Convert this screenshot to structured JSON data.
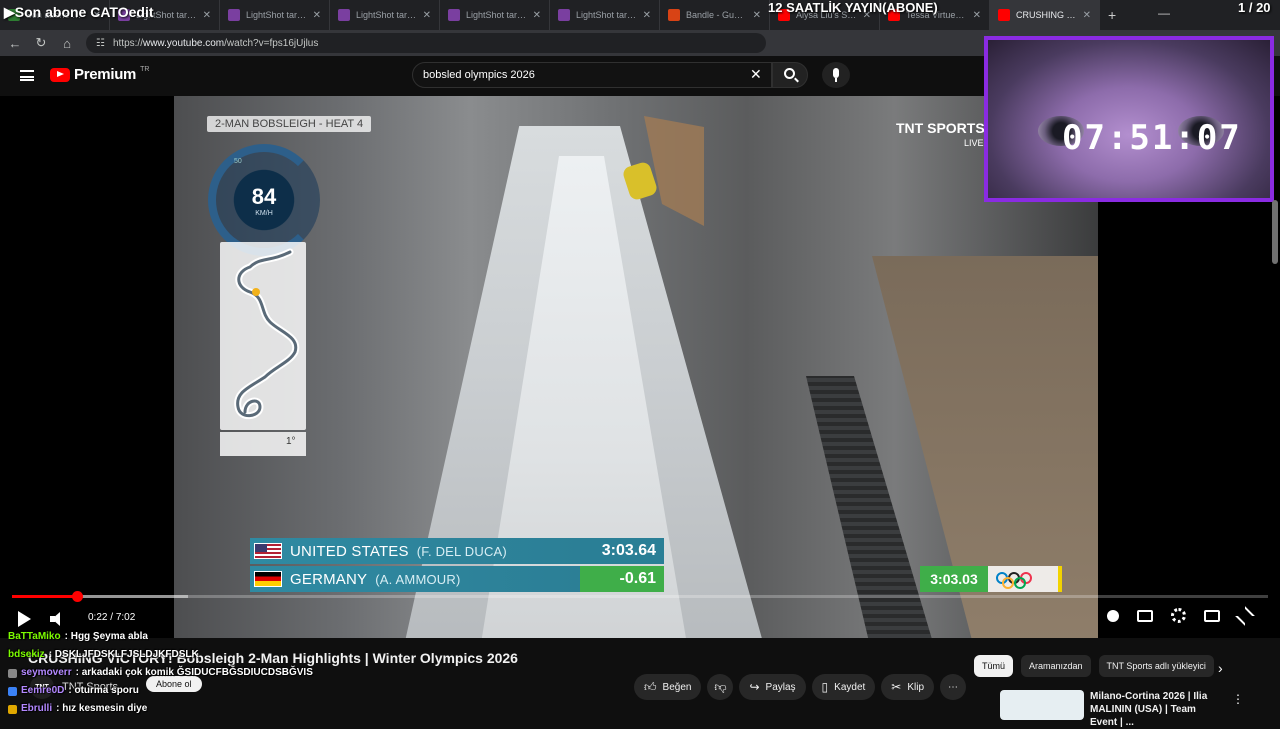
{
  "tabs": [
    {
      "label": "Son abone CATOedit",
      "color": "#2e7d32",
      "active": false
    },
    {
      "label": "LightShot tarafından",
      "color": "#7a3fa0",
      "active": false
    },
    {
      "label": "LightShot tarafından",
      "color": "#7a3fa0",
      "active": false
    },
    {
      "label": "LightShot tarafından",
      "color": "#7a3fa0",
      "active": false
    },
    {
      "label": "LightShot tarafından",
      "color": "#7a3fa0",
      "active": false
    },
    {
      "label": "LightShot tarafından",
      "color": "#7a3fa0",
      "active": false
    },
    {
      "label": "Bandle - Guess the",
      "color": "#d84315",
      "active": false
    },
    {
      "label": "Alysa Liu's STUNNI",
      "color": "#ff0000",
      "active": false
    },
    {
      "label": "Tessa Virtue and Sco",
      "color": "#ff0000",
      "active": false
    },
    {
      "label": "CRUSHING VIC",
      "color": "#ff0000",
      "active": true
    }
  ],
  "overlay": {
    "title": "Son abone CATOedit",
    "banner": "12 SAATLİK YAYIN(ABONE)",
    "count": "1 / 20",
    "clock": "07:51:07"
  },
  "address": {
    "scheme": "https://",
    "host": "www.youtube.com",
    "path": "/watch?v=fps16jUjlus"
  },
  "youtube": {
    "logo": "Premium",
    "region": "TR",
    "search_value": "bobsled olympics 2026",
    "clear_icon": "✕"
  },
  "video_graphics": {
    "heat_label": "2-MAN BOBSLEIGH - HEAT 4",
    "broadcaster": "TNT SPORTS",
    "broadcaster_live": "LIVE",
    "speed_value": "84",
    "speed_unit": "KM/H",
    "speed_scale": "50",
    "map_degree": "1°",
    "scoreboard": [
      {
        "country": "UNITED STATES",
        "athlete": "(F. DEL DUCA)",
        "value": "3:03.64",
        "flag": "us"
      },
      {
        "country": "GERMANY",
        "athlete": "(A. AMMOUR)",
        "value": "-0.61",
        "flag": "de"
      }
    ],
    "reference_time": "3:03.03"
  },
  "player": {
    "time_current": "0:22",
    "time_total": "7:02",
    "played_fraction": 0.052,
    "loaded_fraction": 0.14
  },
  "video_meta": {
    "title": "CRUSHING VICTORY! Bobsleigh 2-Man Highlights | Winter Olympics 2026",
    "channel": "TNT Sports",
    "channel_avatar": "TNT",
    "subscribe": "Abone ol",
    "actions": {
      "like": "Beğen",
      "share": "Paylaş",
      "save": "Kaydet",
      "clip": "Klip"
    }
  },
  "chips": [
    "Tümü",
    "Aramanızdan",
    "TNT Sports adlı yükleyici"
  ],
  "recommendation": {
    "title": "Milano-Cortina 2026 | Ilia MALININ (USA) | Team Event | ..."
  },
  "chat": [
    {
      "user": "BaTTaMiko",
      "msg": ": Hgg Şeyma abla",
      "color": "#7cfc00"
    },
    {
      "user": "bdsekiz",
      "msg": ": DSKLJFDSKLFJSLDJKFDSLK",
      "color": "#7cfc00"
    },
    {
      "user": "seymoverr",
      "msg": ": arkadaki çok komik ĞSIDUCFBĞSDIUCDSBĞVIS",
      "color": "#b388ff"
    },
    {
      "user": "Eemre0D",
      "msg": ": oturma sporu",
      "color": "#b388ff"
    },
    {
      "user": "Ebrulli",
      "msg": ": hız kesmesin diye",
      "color": "#b388ff"
    }
  ]
}
